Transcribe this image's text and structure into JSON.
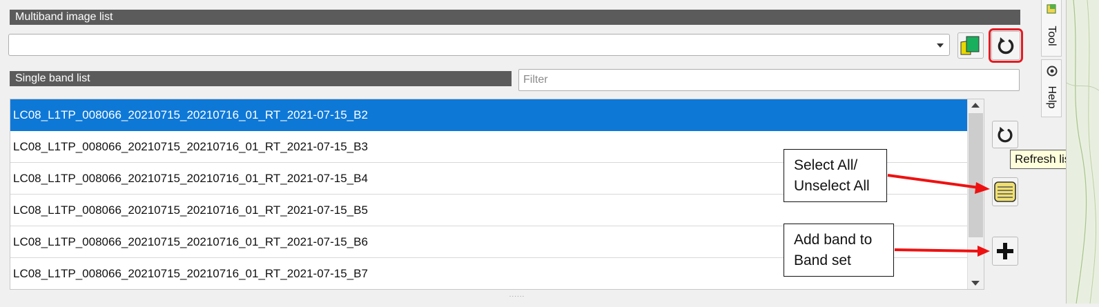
{
  "multiband": {
    "header": "Multiband image list",
    "selected_value": ""
  },
  "singleband": {
    "header": "Single band list",
    "filter_placeholder": "Filter",
    "items": [
      "LC08_L1TP_008066_20210715_20210716_01_RT_2021-07-15_B2",
      "LC08_L1TP_008066_20210715_20210716_01_RT_2021-07-15_B3",
      "LC08_L1TP_008066_20210715_20210716_01_RT_2021-07-15_B4",
      "LC08_L1TP_008066_20210715_20210716_01_RT_2021-07-15_B5",
      "LC08_L1TP_008066_20210715_20210716_01_RT_2021-07-15_B6",
      "LC08_L1TP_008066_20210715_20210716_01_RT_2021-07-15_B7"
    ],
    "selected_index": 0
  },
  "tooltip": "Refresh list",
  "callouts": {
    "select_all": [
      "Select All/",
      "Unselect All"
    ],
    "add_band": [
      "Add band to",
      "Band set"
    ]
  },
  "side_tabs": {
    "tool": "Tool",
    "help": "Help"
  },
  "icons": {
    "multiband_layers": "layers-icon",
    "refresh": "refresh-icon",
    "select_all": "select-all-icon",
    "add": "plus-icon"
  },
  "colors": {
    "selection": "#0e78d7",
    "header_bg": "#5b5b5b",
    "highlight": "#e31b23",
    "annotation_arrow": "#ee1111",
    "tooltip_bg": "#ffffdc"
  }
}
